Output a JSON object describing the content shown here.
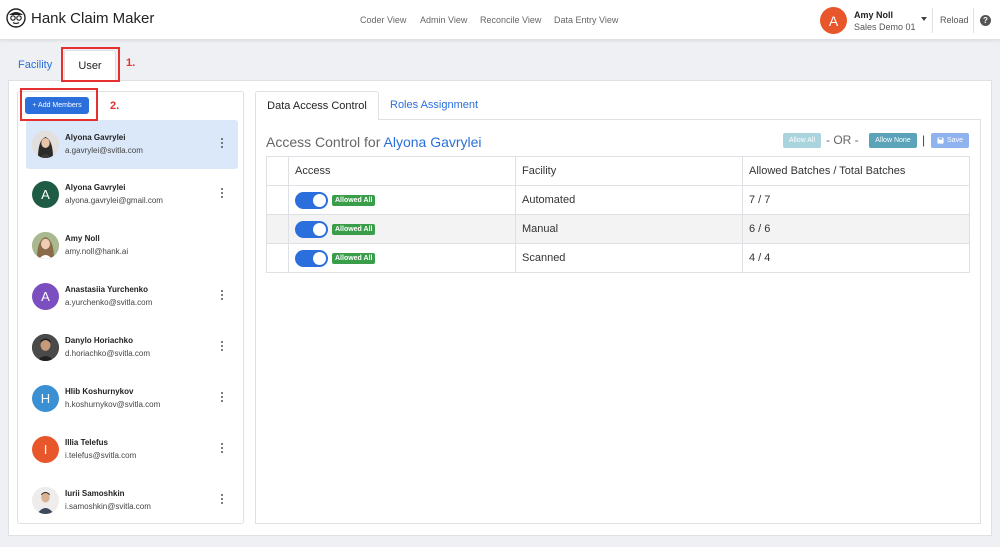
{
  "app": {
    "title": "Hank Claim Maker",
    "logo_icon": "hank-face-logo-icon"
  },
  "nav": {
    "items": [
      "Coder View",
      "Admin View",
      "Reconcile View",
      "Data Entry View"
    ]
  },
  "user_menu": {
    "avatar_initial": "A",
    "avatar_color": "#e8572b",
    "name": "Amy Noll",
    "org": "Sales Demo 01",
    "reload_label": "Reload",
    "help_icon": "question-circle-icon"
  },
  "outer_tabs": {
    "facility": "Facility",
    "user": "User"
  },
  "annotations": {
    "step1": "1.",
    "step2": "2.",
    "highlight_color": "#e53030"
  },
  "members_panel": {
    "add_button": "+ Add Members",
    "members": [
      {
        "name": "Alyona Gavrylei",
        "email": "a.gavrylei@svitla.com",
        "avatar": "photo",
        "active": true
      },
      {
        "name": "Alyona Gavrylei",
        "email": "alyona.gavrylei@gmail.com",
        "avatar": "A",
        "avatar_color": "#1f5c45"
      },
      {
        "name": "Amy Noll",
        "email": "amy.noll@hank.ai",
        "avatar": "photo"
      },
      {
        "name": "Anastasiia Yurchenko",
        "email": "a.yurchenko@svitla.com",
        "avatar": "A",
        "avatar_color": "#7b4fbf"
      },
      {
        "name": "Danylo Horiachko",
        "email": "d.horiachko@svitla.com",
        "avatar": "photo"
      },
      {
        "name": "Hlib Koshurnykov",
        "email": "h.koshurnykov@svitla.com",
        "avatar": "H",
        "avatar_color": "#3b8fd3"
      },
      {
        "name": "Illia Telefus",
        "email": "i.telefus@svitla.com",
        "avatar": "I",
        "avatar_color": "#e8572b"
      },
      {
        "name": "Iurii Samoshkin",
        "email": "i.samoshkin@svitla.com",
        "avatar": "photo"
      }
    ]
  },
  "detail": {
    "tabs": [
      "Data Access Control",
      "Roles Assignment"
    ],
    "title_prefix": "Access Control for",
    "selected_user": "Alyona Gavrylei",
    "buttons": {
      "allow_all": "Allow All",
      "or": "- OR -",
      "allow_none": "Allow None",
      "pipe": "|",
      "save": "Save"
    },
    "table": {
      "headers": [
        "Access",
        "Facility",
        "Allowed Batches / Total Batches"
      ],
      "rows": [
        {
          "enabled": true,
          "badge": "Allowed All",
          "facility": "Automated",
          "batches": "7 / 7"
        },
        {
          "enabled": true,
          "badge": "Allowed All",
          "facility": "Manual",
          "batches": "6 / 6"
        },
        {
          "enabled": true,
          "badge": "Allowed All",
          "facility": "Scanned",
          "batches": "4 / 4"
        }
      ]
    }
  }
}
